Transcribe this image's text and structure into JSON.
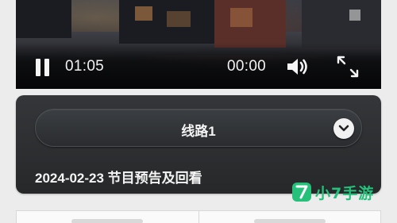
{
  "player": {
    "current_time": "01:05",
    "duration": "00:00",
    "state": "playing",
    "icons": {
      "pause": "pause-icon",
      "volume": "volume-icon",
      "fullscreen": "fullscreen-icon"
    }
  },
  "panel": {
    "route_label": "线路1",
    "program_title": "2024-02-23 节目预告及回看",
    "dropdown_icon": "chevron-down-icon"
  },
  "watermark": {
    "text": "小7手游",
    "logo_color": "#25c07a"
  },
  "colors": {
    "panel_bg": "#2d2f31",
    "page_bg": "#ececec",
    "accent": "#25c07a"
  }
}
